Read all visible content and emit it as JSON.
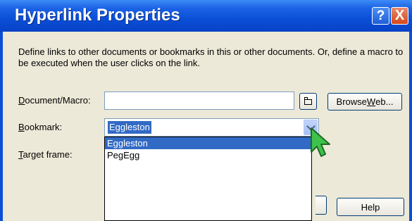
{
  "window": {
    "title": "Hyperlink Properties",
    "help_glyph": "?",
    "close_glyph": "X"
  },
  "description": "Define links to other documents or bookmarks in this or other documents. Or, define a macro to be executed when the user clicks on the link.",
  "fields": {
    "document_label_key": "D",
    "document_label_rest": "ocument/Macro:",
    "document_value": "",
    "bookmark_label_key": "B",
    "bookmark_label_rest": "ookmark:",
    "bookmark_value": "Eggleston",
    "target_label_key": "T",
    "target_label_rest": "arget frame:"
  },
  "buttons": {
    "browse_web_pre": "Browse ",
    "browse_web_key": "W",
    "browse_web_post": "eb...",
    "help": "Help"
  },
  "dropdown": {
    "options": [
      "Eggleston",
      "PegEgg"
    ],
    "highlighted_index": 0
  },
  "colors": {
    "title_bar": "#0a4fd7",
    "selection": "#316ac5",
    "cursor": "#3ec24a"
  },
  "icons": {
    "folder": "folder-icon",
    "dropdown_arrow": "chevron-down-icon",
    "pointer": "mouse-pointer-icon"
  }
}
